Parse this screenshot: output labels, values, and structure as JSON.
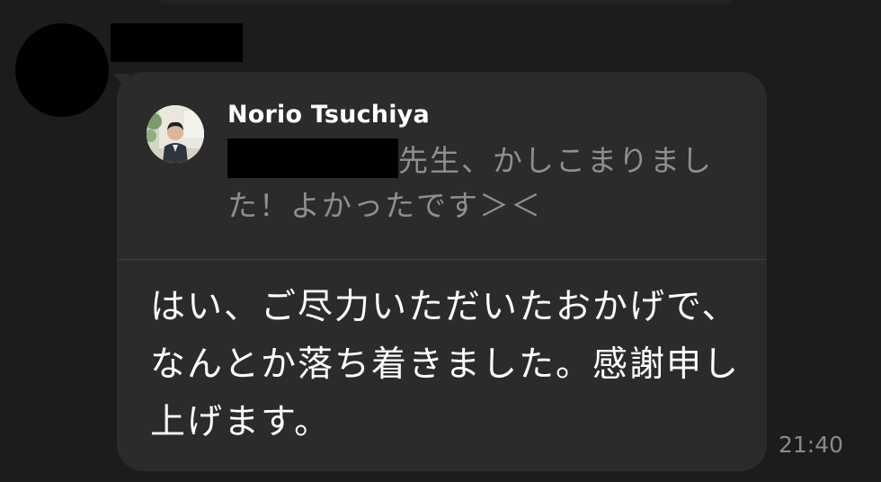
{
  "quote": {
    "author": "Norio Tsuchiya",
    "text": "先生、かしこまりました！よかったです＞＜"
  },
  "message": {
    "text": "はい、ご尽力いただいたおかげで、なんとか落ち着きました。感謝申し上げます。",
    "time": "21:40"
  },
  "colors": {
    "background": "#1c1c1c",
    "bubble": "#2b2b2b",
    "quote_text": "#8f8f8f",
    "timestamp": "#8a8a8a"
  }
}
